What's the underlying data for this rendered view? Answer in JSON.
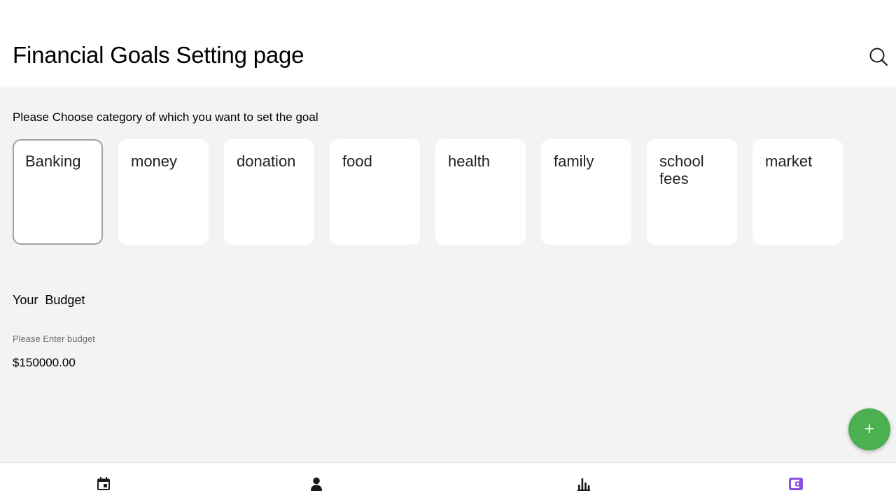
{
  "header": {
    "title": "Financial Goals Setting page",
    "search_icon": "search-icon"
  },
  "categories": {
    "prompt": "Please Choose category of which you want to set the goal",
    "selected_index": 0,
    "items": [
      {
        "label": "Banking"
      },
      {
        "label": "money"
      },
      {
        "label": "donation"
      },
      {
        "label": "food"
      },
      {
        "label": "health"
      },
      {
        "label": "family"
      },
      {
        "label": "school fees"
      },
      {
        "label": "market"
      }
    ]
  },
  "budget": {
    "section_label": "Your  Budget",
    "hint": "Please Enter budget",
    "value": "$150000.00"
  },
  "fab": {
    "label": "+",
    "color": "#4caf50"
  },
  "bottom_nav": {
    "items": [
      {
        "icon": "calendar-icon"
      },
      {
        "icon": "person-icon"
      },
      {
        "icon": "bar-chart-icon"
      },
      {
        "icon": "wallet-icon",
        "active": true
      }
    ],
    "active_color": "#8a4fe0",
    "inactive_color": "#1a1a1a"
  }
}
